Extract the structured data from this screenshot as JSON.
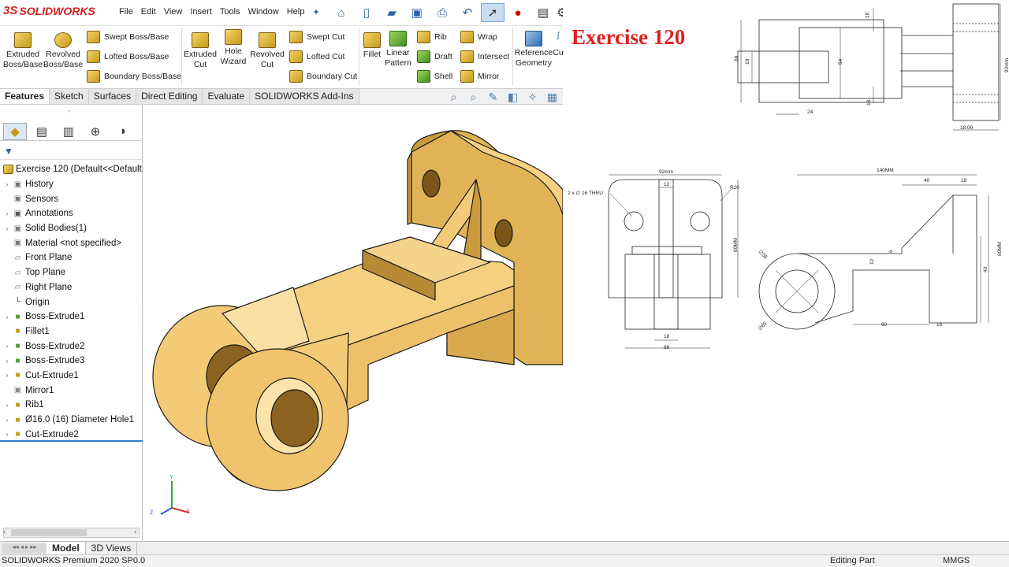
{
  "app": {
    "brand_prefix": "3S",
    "brand_name": "SOLIDWORKS"
  },
  "menu": [
    "File",
    "Edit",
    "View",
    "Insert",
    "Tools",
    "Window",
    "Help"
  ],
  "ribbon": {
    "extruded_boss": "Extruded\nBoss/Base",
    "revolved_boss": "Revolved\nBoss/Base",
    "swept_boss": "Swept Boss/Base",
    "lofted_boss": "Lofted Boss/Base",
    "boundary_boss": "Boundary Boss/Base",
    "extruded_cut": "Extruded\nCut",
    "hole_wizard": "Hole\nWizard",
    "revolved_cut": "Revolved\nCut",
    "swept_cut": "Swept Cut",
    "lofted_cut": "Lofted Cut",
    "boundary_cut": "Boundary Cut",
    "fillet": "Fillet",
    "linear_pattern": "Linear\nPattern",
    "rib": "Rib",
    "draft": "Draft",
    "shell": "Shell",
    "wrap": "Wrap",
    "intersect": "Intersect",
    "mirror": "Mirror",
    "reference_geometry": "Reference\nGeometry",
    "curves": "Cu"
  },
  "tabs": [
    "Features",
    "Sketch",
    "Surfaces",
    "Direct Editing",
    "Evaluate",
    "SOLIDWORKS Add-Ins"
  ],
  "tree": {
    "root": "Exercise 120  (Default<<Default",
    "items": [
      {
        "label": "History",
        "expand": true,
        "icon": "folder-history-icon"
      },
      {
        "label": "Sensors",
        "expand": false,
        "icon": "sensors-icon"
      },
      {
        "label": "Annotations",
        "expand": true,
        "icon": "annotations-icon"
      },
      {
        "label": "Solid Bodies(1)",
        "expand": true,
        "icon": "solid-bodies-icon"
      },
      {
        "label": "Material <not specified>",
        "expand": false,
        "icon": "material-icon"
      },
      {
        "label": "Front Plane",
        "expand": false,
        "icon": "plane-icon"
      },
      {
        "label": "Top Plane",
        "expand": false,
        "icon": "plane-icon"
      },
      {
        "label": "Right Plane",
        "expand": false,
        "icon": "plane-icon"
      },
      {
        "label": "Origin",
        "expand": false,
        "icon": "origin-icon"
      },
      {
        "label": "Boss-Extrude1",
        "expand": true,
        "icon": "boss-extrude-icon"
      },
      {
        "label": "Fillet1",
        "expand": false,
        "icon": "fillet-icon"
      },
      {
        "label": "Boss-Extrude2",
        "expand": true,
        "icon": "boss-extrude-icon"
      },
      {
        "label": "Boss-Extrude3",
        "expand": true,
        "icon": "boss-extrude-icon"
      },
      {
        "label": "Cut-Extrude1",
        "expand": true,
        "icon": "cut-extrude-icon"
      },
      {
        "label": "Mirror1",
        "expand": false,
        "icon": "mirror-icon"
      },
      {
        "label": "Rib1",
        "expand": true,
        "icon": "rib-icon"
      },
      {
        "label": "Ø16.0 (16) Diameter Hole1",
        "expand": true,
        "icon": "hole-icon"
      },
      {
        "label": "Cut-Extrude2",
        "expand": true,
        "icon": "cut-extrude-icon"
      }
    ]
  },
  "bottom_tabs": [
    "Model",
    "3D Views"
  ],
  "status": {
    "left": "SOLIDWORKS Premium 2020 SP0.0",
    "mid": "Editing Part",
    "units": "MMGS"
  },
  "exercise_title": "Exercise 120",
  "triad": {
    "x": "X",
    "y": "Y",
    "z": "Z"
  },
  "drawing_dims": {
    "top": {
      "d18a": "18",
      "d18b": "18",
      "d66": "66",
      "d18c": "18",
      "d54": "54",
      "d24": "24",
      "d92": "92mm",
      "d18_00": "18.00"
    },
    "front": {
      "d92": "92mm",
      "d12": "12",
      "thru": "2 x ∅ 16 THRU",
      "r20": "R20",
      "d80": "80MM",
      "d18": "18",
      "d66": "66"
    },
    "side": {
      "d140": "140MM",
      "d40": "40",
      "d18a": "18",
      "d80": "80MM",
      "d36": "∅36",
      "d6": "6",
      "d12": "12",
      "d40b": "40",
      "d60": "60",
      "d18b": "18",
      "d65": "∅65"
    }
  }
}
